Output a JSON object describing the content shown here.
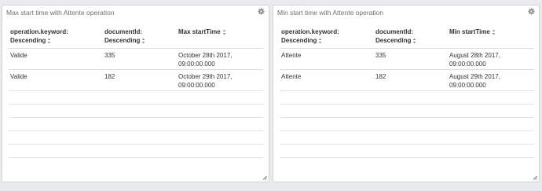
{
  "panels": [
    {
      "title": "Max start time with Attente operation",
      "headers": [
        {
          "line1": "operation.keyword:",
          "line2": "Descending"
        },
        {
          "line1": "documentId:",
          "line2": "Descending"
        },
        {
          "line1": "",
          "line2": "Max startTime"
        }
      ],
      "rows": [
        {
          "c1": "Valide",
          "c2": "335",
          "c3a": "October 28th 2017,",
          "c3b": "09:00:00.000"
        },
        {
          "c1": "Valide",
          "c2": "182",
          "c3a": "October 29th 2017,",
          "c3b": "09:00:00.000"
        }
      ]
    },
    {
      "title": "Min start time with Attente operation",
      "headers": [
        {
          "line1": "operation.keyword:",
          "line2": "Descending"
        },
        {
          "line1": "documentId:",
          "line2": "Descending"
        },
        {
          "line1": "",
          "line2": "Min startTime"
        }
      ],
      "rows": [
        {
          "c1": "Attente",
          "c2": "335",
          "c3a": "August 28th 2017,",
          "c3b": "09:00:00.000"
        },
        {
          "c1": "Attente",
          "c2": "182",
          "c3a": "August 29th 2017,",
          "c3b": "09:00:00.000"
        }
      ]
    }
  ],
  "icons": {
    "settings": "gear-icon",
    "sort": "sort-arrows-icon",
    "resize": "resize-handle-icon"
  },
  "colors": {
    "background": "#e9eaeb",
    "panel": "#ffffff",
    "border": "#d3d3d3",
    "text": "#333333",
    "title": "#6f6f6f"
  }
}
